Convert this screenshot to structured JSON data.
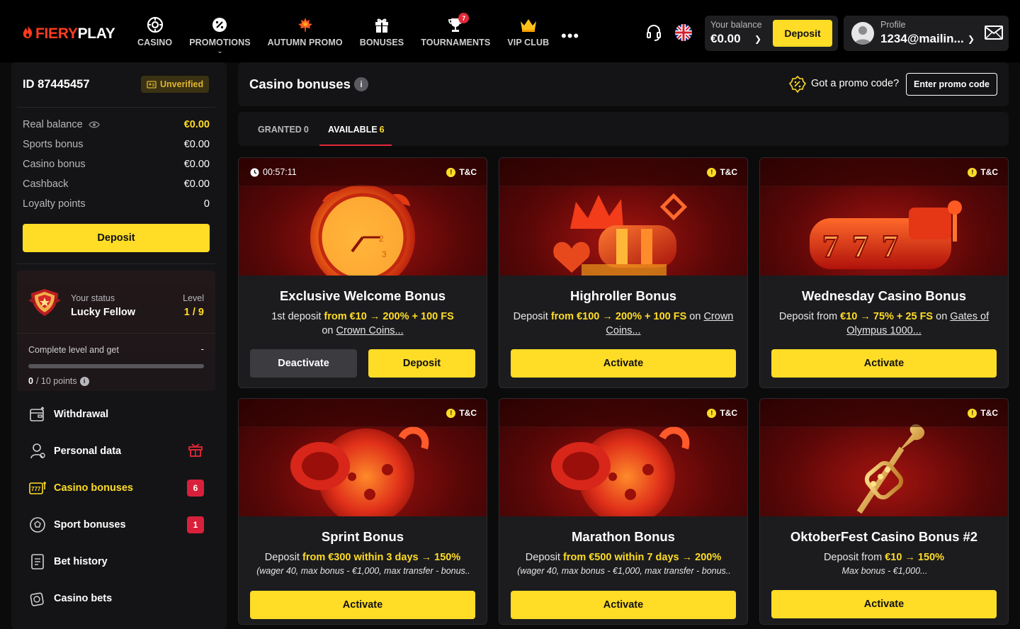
{
  "header": {
    "logo_fiery": "FIERY",
    "logo_play": "PLAY",
    "nav": [
      {
        "label": "CASINO",
        "icon": "roulette-icon"
      },
      {
        "label": "PROMOTIONS",
        "icon": "percent-badge-icon"
      },
      {
        "label": "AUTUMN PROMO",
        "icon": "maple-leaf-icon"
      },
      {
        "label": "BONUSES",
        "icon": "gift-icon"
      },
      {
        "label": "TOURNAMENTS",
        "icon": "trophy-icon",
        "badge": "7"
      },
      {
        "label": "VIP CLUB",
        "icon": "crown-icon"
      }
    ],
    "balance_label": "Your balance",
    "balance_value": "€0.00",
    "deposit_label": "Deposit",
    "profile_label": "Profile",
    "profile_value": "1234@mailin..."
  },
  "sidebar": {
    "user_id": "ID 87445457",
    "verification": "Unverified",
    "balances": [
      {
        "label": "Real balance",
        "value": "€0.00"
      },
      {
        "label": "Sports bonus",
        "value": "€0.00"
      },
      {
        "label": "Casino bonus",
        "value": "€0.00"
      },
      {
        "label": "Cashback",
        "value": "€0.00"
      },
      {
        "label": "Loyalty points",
        "value": "0"
      }
    ],
    "deposit_label": "Deposit",
    "status": {
      "your_status_label": "Your status",
      "status_name": "Lucky Fellow",
      "level_label": "Level",
      "level_value": "1 / 9",
      "complete_label": "Complete level and get",
      "complete_value": "-",
      "points_current": "0",
      "points_total": "/ 10 points",
      "progress": 0
    },
    "menu": [
      {
        "label": "Withdrawal",
        "icon": "withdrawal-icon"
      },
      {
        "label": "Personal data",
        "icon": "user-icon"
      },
      {
        "label": "Casino bonuses",
        "icon": "slot-777-icon",
        "badge": "6"
      },
      {
        "label": "Sport bonuses",
        "icon": "soccer-ball-icon",
        "badge": "1"
      },
      {
        "label": "Bet history",
        "icon": "receipt-icon"
      },
      {
        "label": "Casino bets",
        "icon": "casino-chip-icon"
      }
    ]
  },
  "main": {
    "title": "Casino bonuses",
    "promo_question": "Got a promo code?",
    "promo_button": "Enter promo code",
    "tabs": [
      {
        "label": "GRANTED",
        "count": "0"
      },
      {
        "label": "AVAILABLE",
        "count": "6"
      }
    ],
    "tc_label": "T&C",
    "cards": [
      {
        "timer": "00:57:11",
        "title": "Exclusive Welcome Bonus",
        "desc_a": "1st deposit ",
        "desc_b": "from €10 → 200% + 100 FS",
        "desc_c": "on ",
        "desc_d": "Crown Coins...",
        "deactivate": "Deactivate",
        "deposit": "Deposit",
        "art": "alarm-clock-art"
      },
      {
        "title": "Highroller Bonus",
        "desc_a": "Deposit ",
        "desc_b": "from €100 → 200% + 100 FS",
        "desc_c": " on ",
        "desc_d": "Crown Coins...",
        "button": "Activate",
        "art": "crown-slot-art"
      },
      {
        "title": "Wednesday Casino Bonus",
        "desc_a": "Deposit from ",
        "desc_b": "€10 → 75% + 25 FS",
        "desc_c": " on ",
        "desc_d": "Gates of Olympus 1000...",
        "button": "Activate",
        "art": "slot-777-art"
      },
      {
        "title": "Sprint Bonus",
        "desc_a": "Deposit ",
        "desc_b": "from €300 within 3 days → 150%",
        "note": "(wager 40, max bonus - €1,000, max transfer - bonus..",
        "button": "Activate",
        "art": "stopwatch-art"
      },
      {
        "title": "Marathon Bonus",
        "desc_a": "Deposit ",
        "desc_b": "from €500 within 7 days → 200%",
        "note": "(wager 40, max bonus - €1,000, max transfer - bonus..",
        "button": "Activate",
        "art": "stopwatch-art"
      },
      {
        "title": "OktoberFest Casino Bonus #2",
        "desc_a": "Deposit from ",
        "desc_b": "€10 → 150%",
        "note": "Max bonus - €1,000...",
        "button": "Activate",
        "art": "trumpet-art"
      }
    ]
  },
  "colors": {
    "accent_yellow": "#ffdc26",
    "brand_red": "#ff3b1f",
    "badge_red": "#d9203a",
    "panel_bg": "#141416"
  }
}
